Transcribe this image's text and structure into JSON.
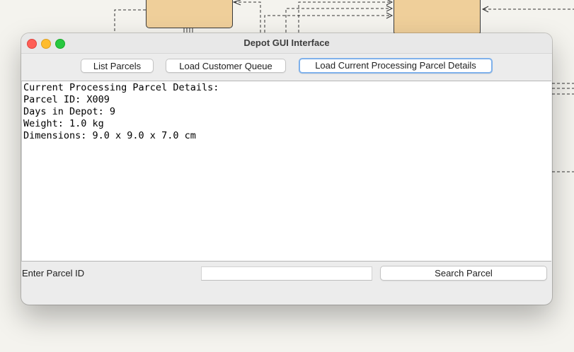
{
  "window": {
    "title": "Depot GUI Interface"
  },
  "toolbar": {
    "list_parcels_label": "List Parcels",
    "load_queue_label": "Load Customer Queue",
    "load_current_label": "Load Current Processing Parcel Details"
  },
  "output": {
    "lines": [
      "Current Processing Parcel Details:",
      "Parcel ID: X009",
      "Days in Depot: 9",
      "Weight: 1.0 kg",
      "Dimensions: 9.0 x 9.0 x 7.0 cm"
    ]
  },
  "search": {
    "label": "Enter Parcel ID",
    "value": "",
    "button_label": "Search Parcel"
  },
  "colors": {
    "close": "#fe5f57",
    "minimize": "#febc2e",
    "maximize": "#28c840",
    "focus_ring": "#7fb1eb",
    "diagram_box": "#efcf9a"
  }
}
